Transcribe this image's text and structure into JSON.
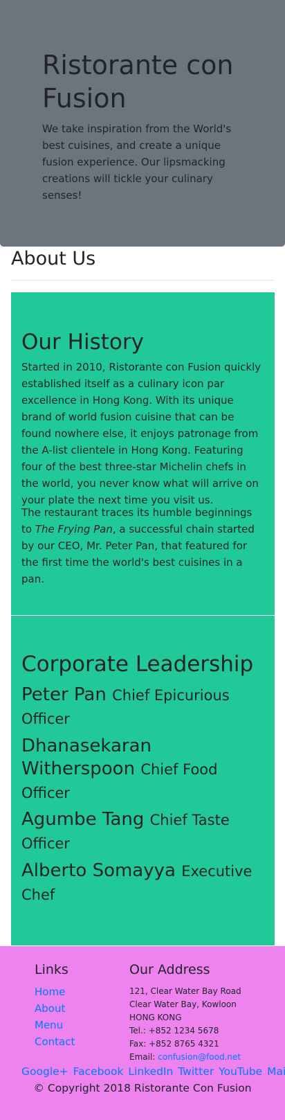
{
  "hero": {
    "title": "Ristorante con Fusion",
    "text": "We take inspiration from the World's best cuisines, and create a unique fusion experience. Our lipsmacking creations will tickle your culinary senses!",
    "background_color": "#6c757d"
  },
  "about": {
    "heading": "About Us"
  },
  "history": {
    "title": "Our History",
    "paragraph1": "Started in 2010, Ristorante con Fusion quickly established itself as a culinary icon par excellence in Hong Kong. With its unique brand of world fusion cuisine that can be found nowhere else, it enjoys patronage from the A-list clientele in Hong Kong. Featuring four of the best three-star Michelin chefs in the world, you never know what will arrive on your plate the next time you visit us.",
    "paragraph2_before": "The restaurant traces its humble beginnings to ",
    "paragraph2_italic": "The Frying Pan",
    "paragraph2_after": ", a successful chain started by our CEO, Mr. Peter Pan, that featured for the first time the world's best cuisines in a pan.",
    "background_color": "#20c997"
  },
  "leadership": {
    "title": "Corporate Leadership",
    "leaders": [
      {
        "name": "Peter Pan",
        "role": "Chief Epicurious Officer"
      },
      {
        "name": "Dhanasekaran Witherspoon",
        "role": "Chief Food Officer"
      },
      {
        "name": "Agumbe Tang",
        "role": "Chief Taste Officer"
      },
      {
        "name": "Alberto Somayya",
        "role": "Executive Chef"
      }
    ]
  },
  "footer": {
    "links_heading": "Links",
    "links": [
      "Home",
      "About",
      "Menu",
      "Contact"
    ],
    "address_heading": "Our Address",
    "address_lines": [
      "121, Clear Water Bay Road",
      "Clear Water Bay, Kowloon",
      "HONG KONG",
      "Tel.: +852 1234 5678",
      "Fax: +852 8765 4321"
    ],
    "email_label": "Email: ",
    "email": "confusion@food.net",
    "social": [
      "Google+",
      "Facebook",
      "LinkedIn",
      "Twitter",
      "YouTube",
      "Mail"
    ],
    "copyright": "© Copyright 2018 Ristorante Con Fusion",
    "background_color": "#ee82ee",
    "link_color": "#007bff"
  }
}
